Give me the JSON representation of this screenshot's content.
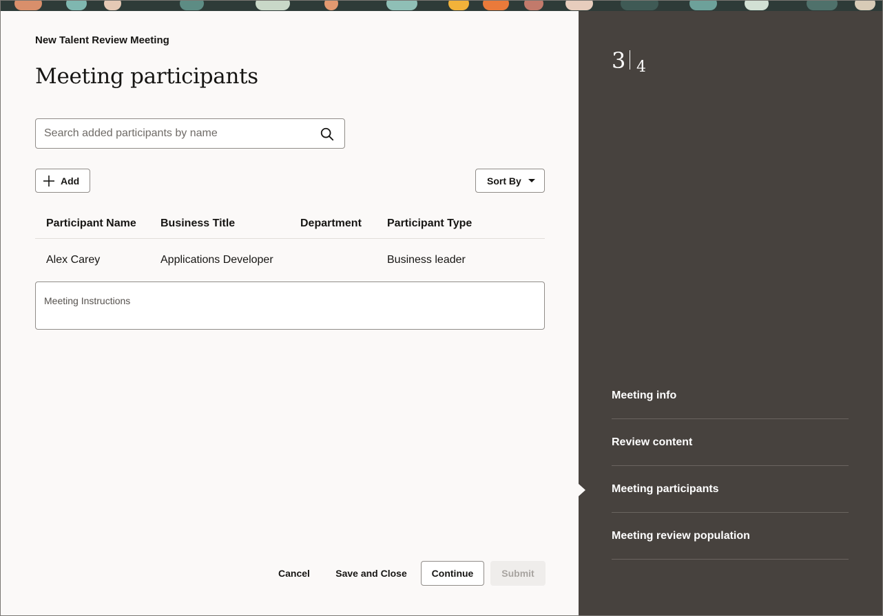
{
  "header": {
    "context_title": "New Talent Review Meeting",
    "page_title": "Meeting participants"
  },
  "search": {
    "placeholder": "Search added participants by name",
    "value": "",
    "icon": "search-icon"
  },
  "toolbar": {
    "add_label": "Add",
    "add_icon": "plus-icon",
    "sort_label": "Sort By",
    "sort_icon": "caret-down-icon"
  },
  "table": {
    "columns": [
      "Participant Name",
      "Business Title",
      "Department",
      "Participant Type"
    ],
    "rows": [
      [
        "Alex Carey",
        "Applications Developer",
        "",
        "Business leader"
      ]
    ]
  },
  "instructions": {
    "label": "Meeting Instructions",
    "value": ""
  },
  "footer": {
    "cancel_label": "Cancel",
    "save_close_label": "Save and Close",
    "continue_label": "Continue",
    "submit_label": "Submit"
  },
  "stepper": {
    "current": "3",
    "total": "4",
    "items": [
      {
        "label": "Meeting info"
      },
      {
        "label": "Review content"
      },
      {
        "label": "Meeting participants"
      },
      {
        "label": "Meeting review population"
      }
    ]
  },
  "colors": {
    "side_panel_bg": "#47423e",
    "main_bg": "#fbf9f8",
    "text": "#161513",
    "submit_disabled_bg": "#efedeb"
  }
}
